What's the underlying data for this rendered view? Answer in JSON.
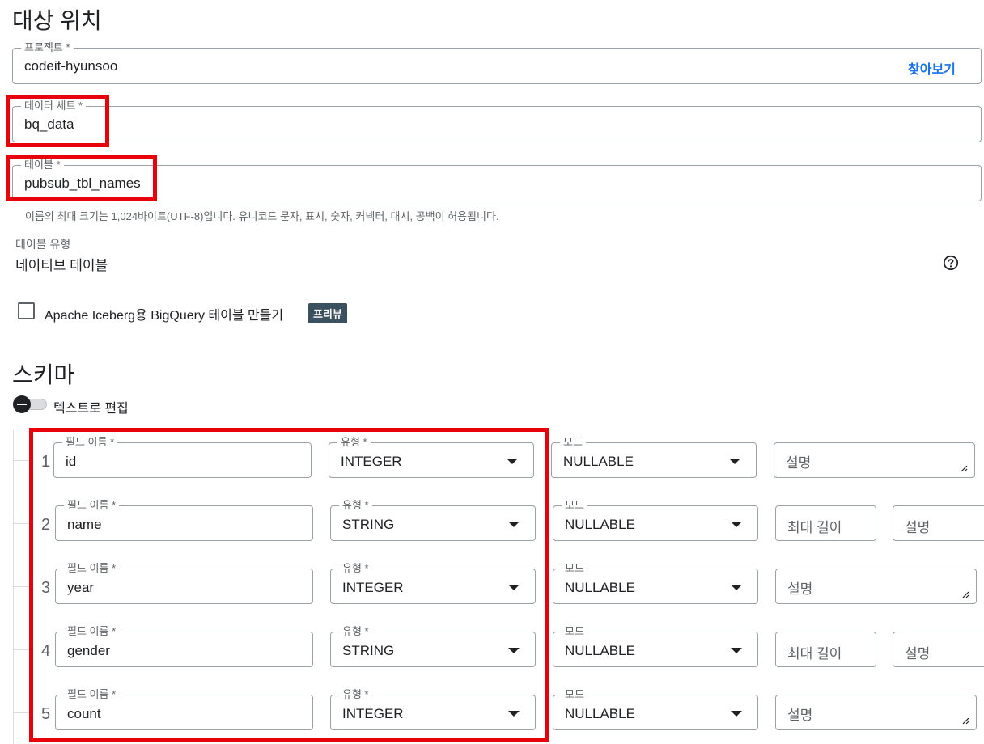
{
  "destination": {
    "title": "대상 위치",
    "project": {
      "label": "프로젝트 *",
      "value": "codeit-hyunsoo",
      "browse_label": "찾아보기"
    },
    "dataset": {
      "label": "데이터 세트 *",
      "value": "bq_data"
    },
    "table": {
      "label": "테이블 *",
      "value": "pubsub_tbl_names",
      "hint": "이름의 최대 크기는 1,024바이트(UTF-8)입니다. 유니코드 문자, 표시, 숫자, 커넥터, 대시, 공백이 허용됩니다."
    },
    "table_type": {
      "label": "테이블 유형",
      "value": "네이티브 테이블"
    },
    "iceberg": {
      "label": "Apache Iceberg용 BigQuery 테이블 만들기",
      "badge": "프리뷰",
      "checked": false
    }
  },
  "schema": {
    "title": "스키마",
    "edit_as_text_label": "텍스트로 편집",
    "field_name_label": "필드 이름 *",
    "type_label": "유형 *",
    "mode_label": "모드",
    "max_length_placeholder": "최대 길이",
    "description_placeholder": "설명",
    "rows": [
      {
        "num": "1",
        "name": "id",
        "type": "INTEGER",
        "mode": "NULLABLE"
      },
      {
        "num": "2",
        "name": "name",
        "type": "STRING",
        "mode": "NULLABLE"
      },
      {
        "num": "3",
        "name": "year",
        "type": "INTEGER",
        "mode": "NULLABLE"
      },
      {
        "num": "4",
        "name": "gender",
        "type": "STRING",
        "mode": "NULLABLE"
      },
      {
        "num": "5",
        "name": "count",
        "type": "INTEGER",
        "mode": "NULLABLE"
      }
    ]
  },
  "colors": {
    "accent": "#1a73e8",
    "highlight": "#e8000b",
    "badge": "#3c5160"
  }
}
